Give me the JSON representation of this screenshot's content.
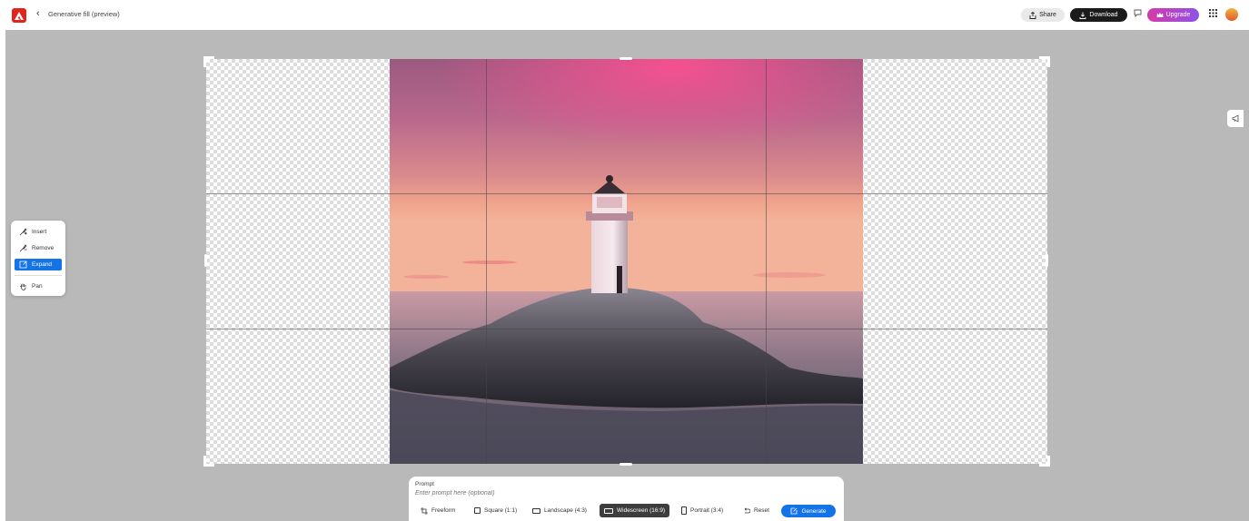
{
  "header": {
    "back_glyph": "‹",
    "title": "Generative fill (preview)",
    "share_label": "Share",
    "download_label": "Download",
    "upgrade_label": "Upgrade"
  },
  "tools": {
    "items": [
      {
        "label": "Insert",
        "icon": "insert-brush-icon",
        "active": false
      },
      {
        "label": "Remove",
        "icon": "remove-brush-icon",
        "active": false
      },
      {
        "label": "Expand",
        "icon": "expand-icon",
        "active": true
      },
      {
        "label": "Pan",
        "icon": "hand-icon",
        "active": false
      }
    ]
  },
  "prompt": {
    "label": "Prompt",
    "placeholder": "Enter prompt here (optional)",
    "aspects": [
      {
        "label": "Freeform",
        "icon": "crop-icon",
        "active": false
      },
      {
        "label": "Square (1:1)",
        "icon": "square-icon",
        "active": false
      },
      {
        "label": "Landscape (4:3)",
        "icon": "landscape-icon",
        "active": false
      },
      {
        "label": "Widescreen (16:9)",
        "icon": "widescreen-icon",
        "active": true
      },
      {
        "label": "Portrait (3:4)",
        "icon": "portrait-icon",
        "active": false
      },
      {
        "label": "Reset",
        "icon": "reset-icon",
        "active": false
      }
    ],
    "generate_label": "Generate"
  },
  "colors": {
    "accent": "#1473e6",
    "brand": "#e1251b",
    "workspace": "#b9b9b9"
  }
}
